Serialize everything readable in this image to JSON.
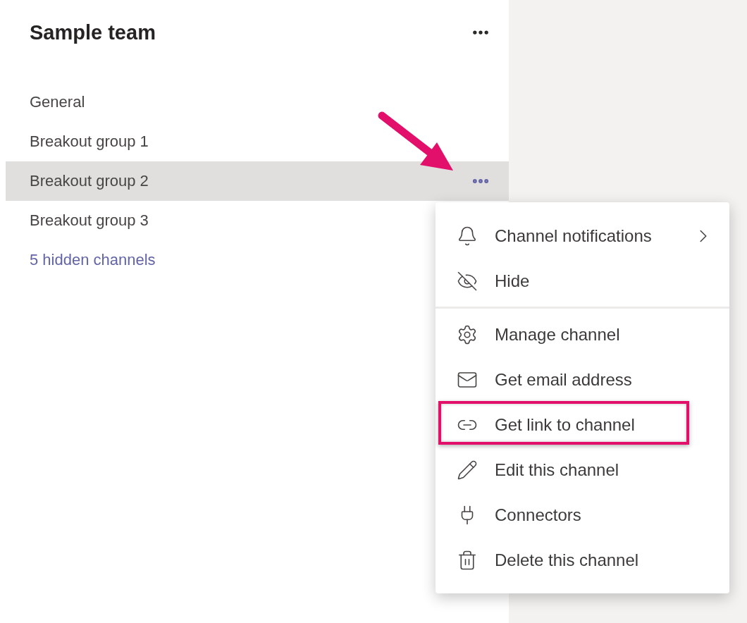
{
  "team": {
    "title": "Sample team"
  },
  "channels": [
    {
      "kind": "channel",
      "label": "General",
      "selected": false
    },
    {
      "kind": "channel",
      "label": "Breakout group 1",
      "selected": false
    },
    {
      "kind": "channel",
      "label": "Breakout group 2",
      "selected": true
    },
    {
      "kind": "channel",
      "label": "Breakout group 3",
      "selected": false
    },
    {
      "kind": "link",
      "label": "5 hidden channels",
      "selected": false
    }
  ],
  "menu": {
    "sections": [
      [
        {
          "label": "Channel notifications",
          "submenu": true,
          "highlighted": false
        },
        {
          "label": "Hide",
          "submenu": false,
          "highlighted": false
        }
      ],
      [
        {
          "label": "Manage channel",
          "submenu": false,
          "highlighted": false
        },
        {
          "label": "Get email address",
          "submenu": false,
          "highlighted": false
        },
        {
          "label": "Get link to channel",
          "submenu": false,
          "highlighted": true
        },
        {
          "label": "Edit this channel",
          "submenu": false,
          "highlighted": false
        },
        {
          "label": "Connectors",
          "submenu": false,
          "highlighted": false
        },
        {
          "label": "Delete this channel",
          "submenu": false,
          "highlighted": false
        }
      ]
    ]
  }
}
